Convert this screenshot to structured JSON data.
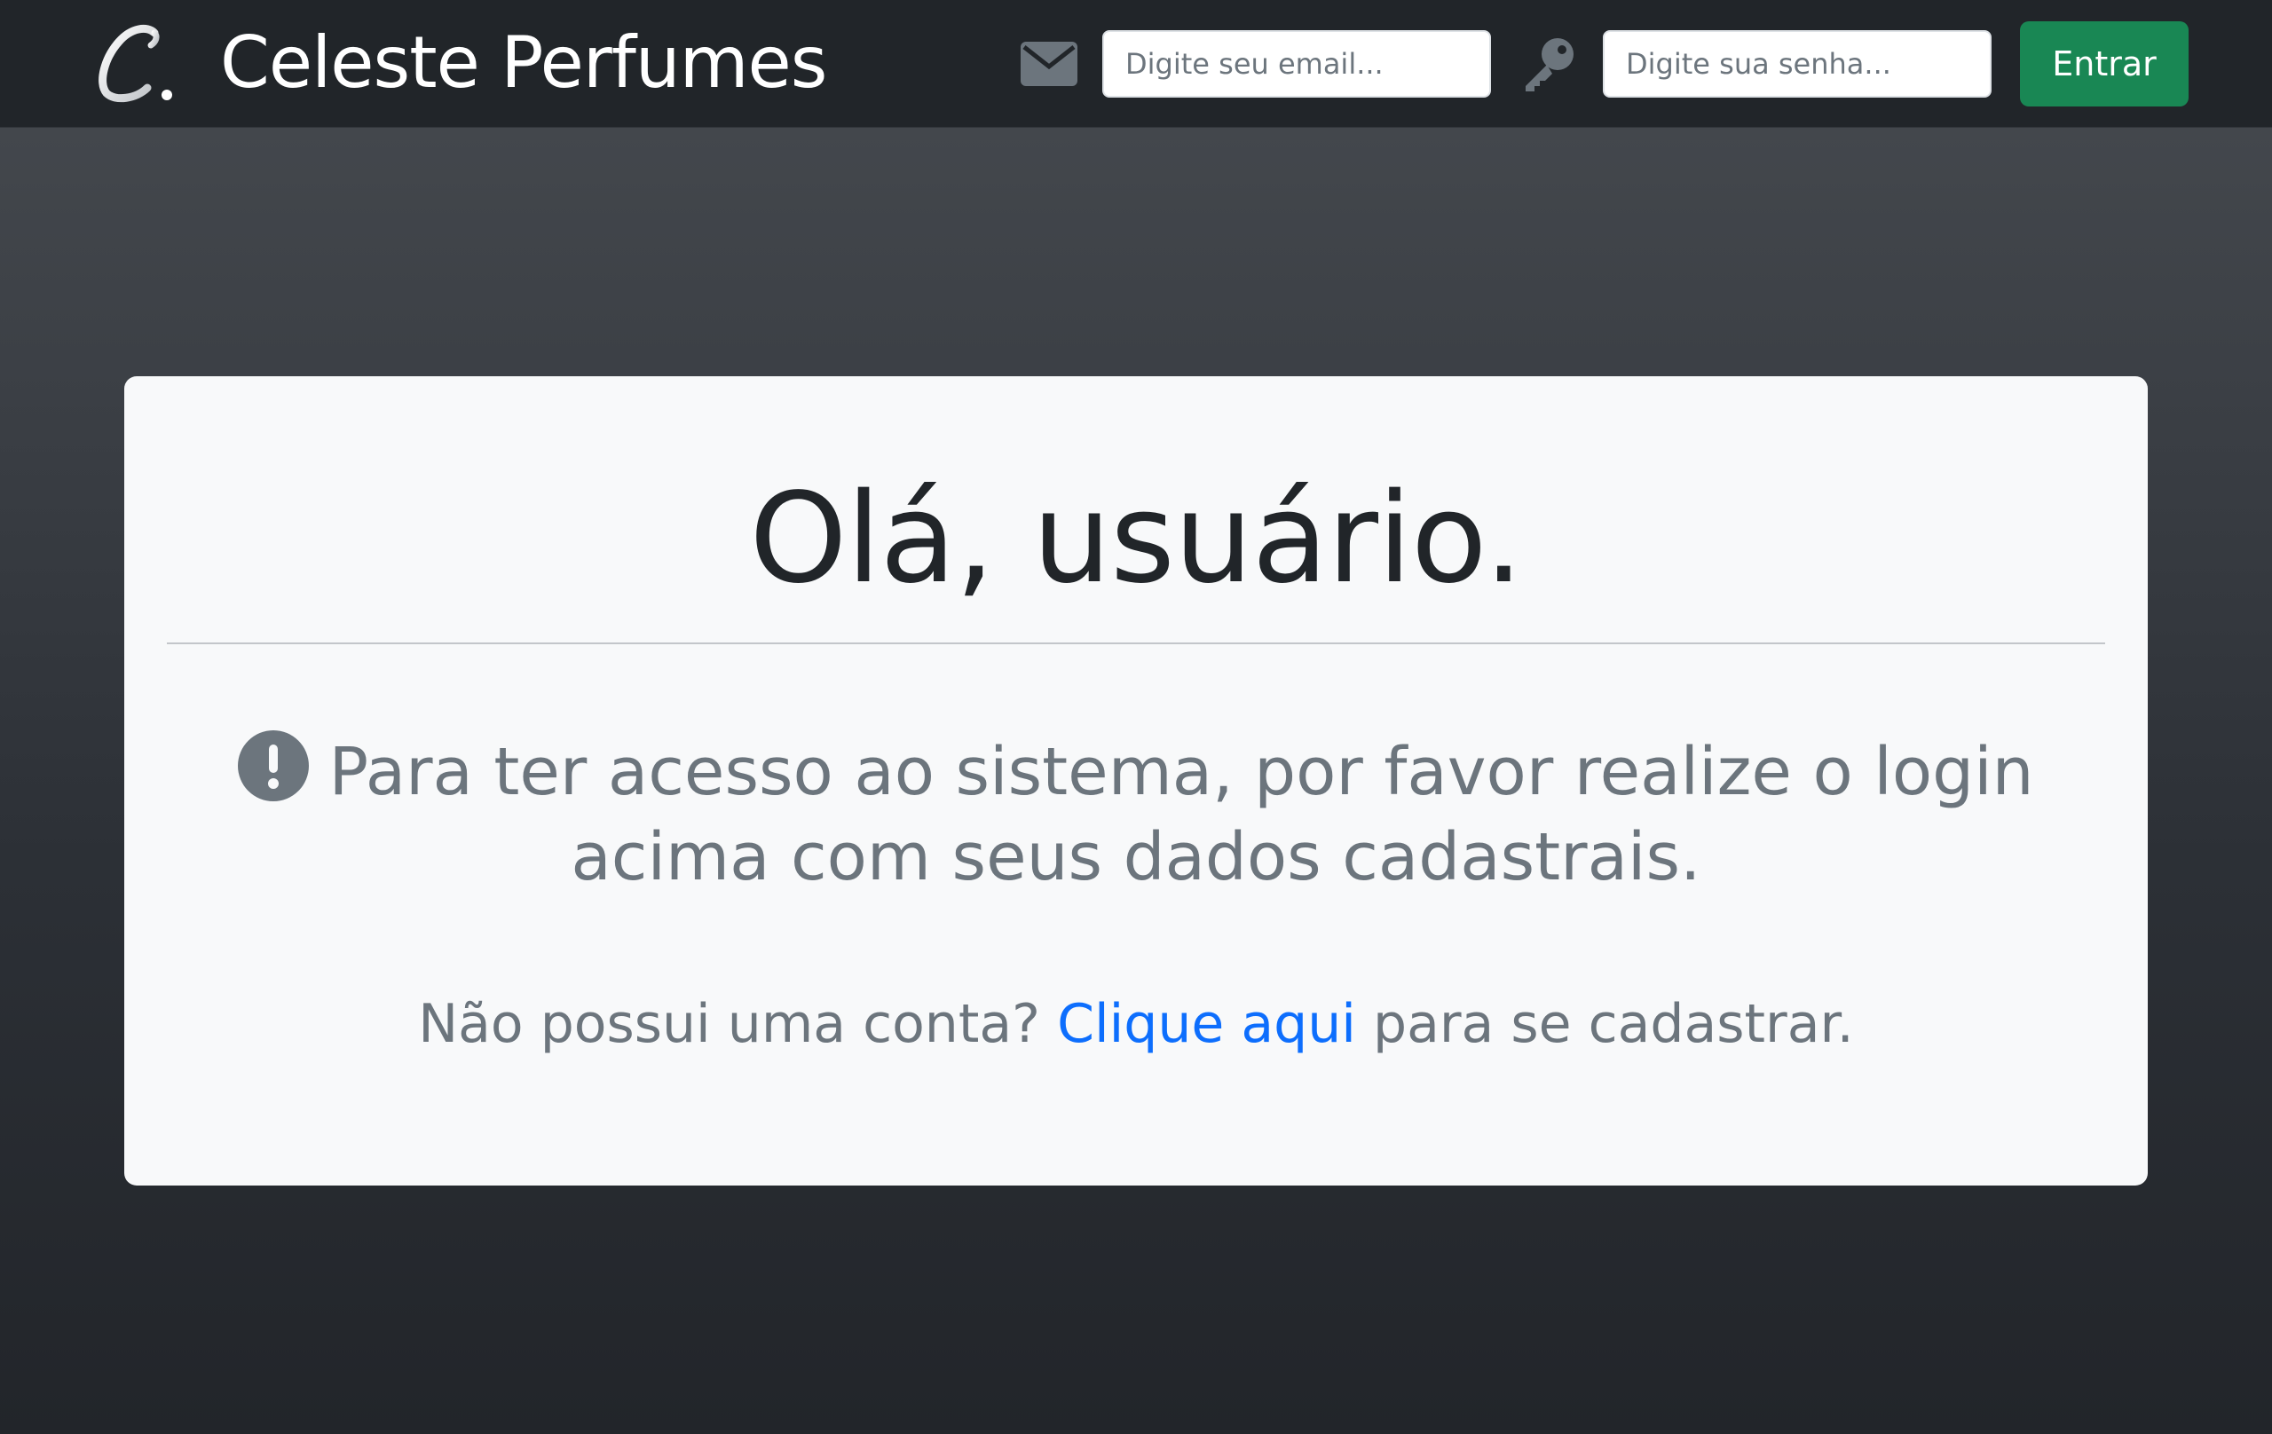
{
  "navbar": {
    "brand_name": "Celeste Perfumes",
    "brand_logo": "script-c-logo",
    "email_icon": "envelope-icon",
    "key_icon": "key-icon",
    "email_placeholder": "Digite seu email...",
    "email_value": "",
    "password_placeholder": "Digite sua senha...",
    "password_value": "",
    "login_button": "Entrar"
  },
  "main": {
    "greeting": "Olá, usuário.",
    "notice_icon": "exclamation-circle-icon",
    "notice_text": "Para ter acesso ao sistema, por favor realize o login acima com seus dados cadastrais.",
    "signup_prefix": "Não possui uma conta?",
    "signup_link": "Clique aqui",
    "signup_suffix": "para se cadastrar."
  },
  "colors": {
    "navbar_bg": "#212529",
    "login_button": "#198754",
    "link": "#0d6efd",
    "card_bg": "#f8f9fa",
    "muted_text": "#6c757d"
  }
}
